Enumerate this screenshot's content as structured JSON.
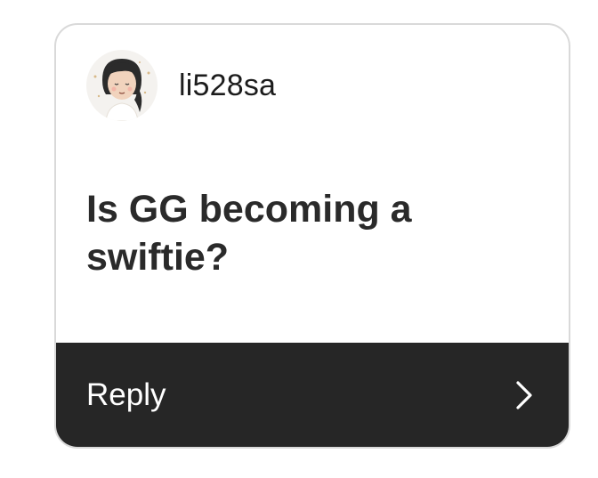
{
  "post": {
    "username": "li528sa",
    "question": "Is GG becoming a swiftie?",
    "avatar_icon": "cartoon-girl-avatar"
  },
  "reply": {
    "label": "Reply",
    "icon": "chevron-right-icon"
  },
  "colors": {
    "reply_bar_bg": "#262626",
    "card_border": "#d9d9d9",
    "text": "#2a2a2a"
  }
}
